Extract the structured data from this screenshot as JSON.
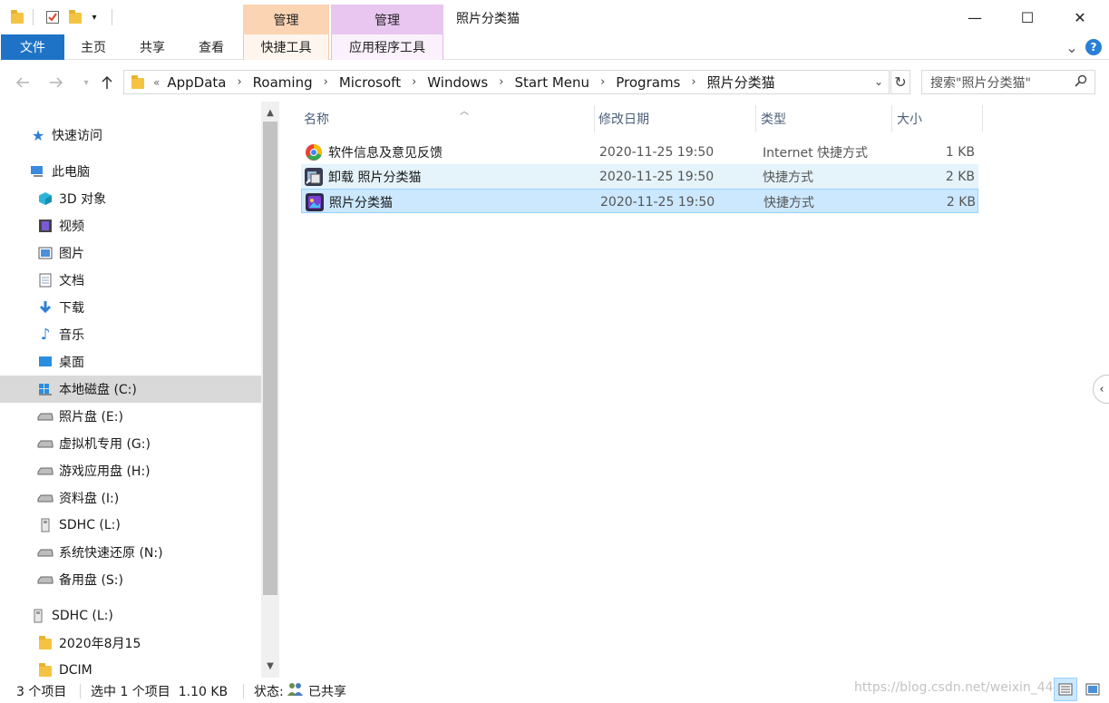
{
  "window": {
    "title": "照片分类猫",
    "context_tabs": [
      {
        "label": "管理"
      },
      {
        "label": "管理"
      }
    ],
    "controls": {
      "minimize": "—",
      "maximize": "☐",
      "close": "✕"
    }
  },
  "ribbon": {
    "tabs": [
      "文件",
      "主页",
      "共享",
      "查看",
      "快捷工具",
      "应用程序工具"
    ],
    "collapse_glyph": "⌄",
    "help_glyph": "?"
  },
  "address": {
    "overflow": "«",
    "crumbs": [
      "AppData",
      "Roaming",
      "Microsoft",
      "Windows",
      "Start Menu",
      "Programs",
      "照片分类猫"
    ],
    "separator": "›",
    "search_placeholder": "搜索\"照片分类猫\""
  },
  "sidebar": {
    "items": [
      {
        "label": "快速访问",
        "icon": "star-icon"
      },
      {
        "label": "此电脑",
        "icon": "pc-icon"
      },
      {
        "label": "3D 对象",
        "icon": "cube-icon"
      },
      {
        "label": "视频",
        "icon": "video-icon"
      },
      {
        "label": "图片",
        "icon": "picture-icon"
      },
      {
        "label": "文档",
        "icon": "document-icon"
      },
      {
        "label": "下载",
        "icon": "download-icon"
      },
      {
        "label": "音乐",
        "icon": "music-icon"
      },
      {
        "label": "桌面",
        "icon": "desktop-icon"
      },
      {
        "label": "本地磁盘 (C:)",
        "icon": "system-drive-icon",
        "selected": true
      },
      {
        "label": "照片盘 (E:)",
        "icon": "drive-icon"
      },
      {
        "label": "虚拟机专用 (G:)",
        "icon": "drive-icon"
      },
      {
        "label": "游戏应用盘 (H:)",
        "icon": "drive-icon"
      },
      {
        "label": "资料盘 (I:)",
        "icon": "drive-icon"
      },
      {
        "label": "SDHC (L:)",
        "icon": "sd-card-icon"
      },
      {
        "label": "系统快速还原 (N:)",
        "icon": "drive-icon"
      },
      {
        "label": "备用盘 (S:)",
        "icon": "drive-icon"
      },
      {
        "label": "SDHC (L:)",
        "icon": "sd-card-icon"
      },
      {
        "label": "2020年8月15",
        "icon": "folder-icon"
      },
      {
        "label": "DCIM",
        "icon": "folder-icon"
      }
    ]
  },
  "filelist": {
    "columns": [
      "名称",
      "修改日期",
      "类型",
      "大小"
    ],
    "rows": [
      {
        "name": "软件信息及意见反馈",
        "date": "2020-11-25 19:50",
        "type": "Internet 快捷方式",
        "size": "1 KB",
        "icon": "internet-shortcut-icon"
      },
      {
        "name": "卸载 照片分类猫",
        "date": "2020-11-25 19:50",
        "type": "快捷方式",
        "size": "2 KB",
        "icon": "uninstall-icon",
        "state": "hover"
      },
      {
        "name": "照片分类猫",
        "date": "2020-11-25 19:50",
        "type": "快捷方式",
        "size": "2 KB",
        "icon": "app-icon",
        "state": "selected"
      }
    ]
  },
  "status": {
    "count": "3 个项目",
    "selection": "选中 1 个项目  1.10 KB",
    "state_label": "状态:",
    "state_value": "已共享",
    "watermark": "https://blog.csdn.net/weixin_44"
  },
  "colors": {
    "file_tab": "#1e73c6",
    "context_orange": "#fbd4b4",
    "context_purple": "#e8c6f0",
    "selection": "#cce8ff",
    "hover": "#e5f3fb",
    "sidebar_selected": "#d9d9d9"
  }
}
